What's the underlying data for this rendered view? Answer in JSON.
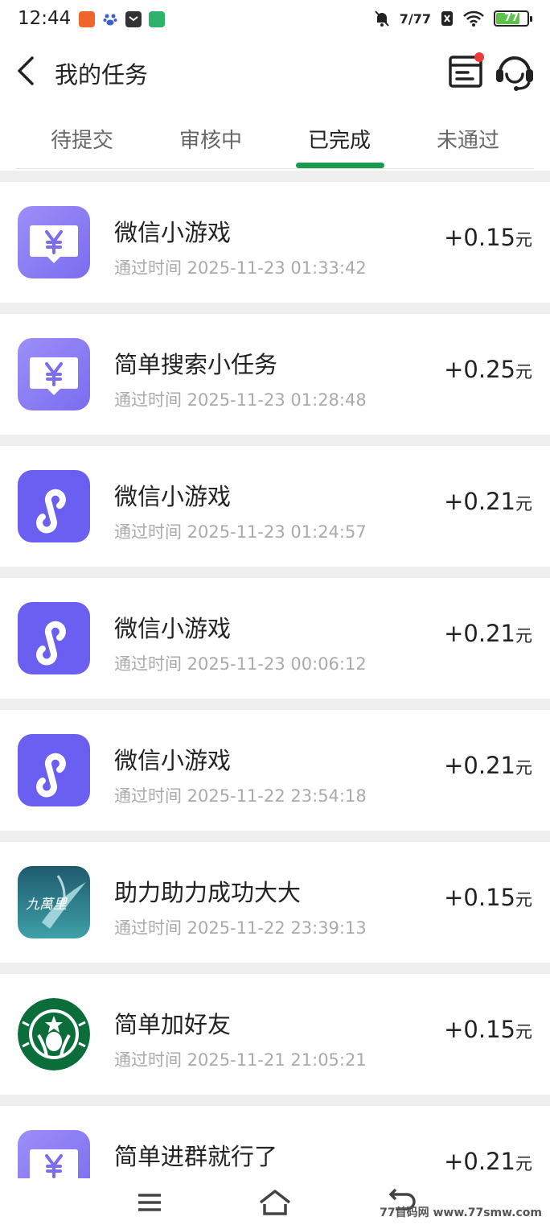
{
  "status_bar": {
    "time": "12:44",
    "signal_text": "7/77",
    "battery_level": "77",
    "notification_icons": [
      {
        "name": "app-orange-icon",
        "color": "#f0662a"
      },
      {
        "name": "paw-icon",
        "color": "#3a5fcf"
      },
      {
        "name": "mail-app-icon",
        "color": "#333333"
      },
      {
        "name": "green-app-icon",
        "color": "#2fb36a"
      }
    ]
  },
  "header": {
    "title": "我的任务"
  },
  "tabs": [
    {
      "label": "待提交",
      "active": false
    },
    {
      "label": "审核中",
      "active": false
    },
    {
      "label": "已完成",
      "active": true
    },
    {
      "label": "未通过",
      "active": false
    }
  ],
  "accent_color": "#1a9a4c",
  "tasks": [
    {
      "title": "微信小游戏",
      "time": "通过时间 2025-11-23 01:33:42",
      "amount": "+0.15",
      "unit": "元",
      "icon": "yuan-icon"
    },
    {
      "title": "简单搜索小任务",
      "time": "通过时间 2025-11-23 01:28:48",
      "amount": "+0.25",
      "unit": "元",
      "icon": "yuan-icon"
    },
    {
      "title": "微信小游戏",
      "time": "通过时间 2025-11-23 01:24:57",
      "amount": "+0.21",
      "unit": "元",
      "icon": "mini-program-icon"
    },
    {
      "title": "微信小游戏",
      "time": "通过时间 2025-11-23 00:06:12",
      "amount": "+0.21",
      "unit": "元",
      "icon": "mini-program-icon"
    },
    {
      "title": "微信小游戏",
      "time": "通过时间 2025-11-22 23:54:18",
      "amount": "+0.21",
      "unit": "元",
      "icon": "mini-program-icon"
    },
    {
      "title": "助力助力成功大大",
      "time": "通过时间 2025-11-22 23:39:13",
      "amount": "+0.15",
      "unit": "元",
      "icon": "jiuwanli-logo-icon",
      "logo_text": "九萬里"
    },
    {
      "title": "简单加好友",
      "time": "通过时间 2025-11-21 21:05:21",
      "amount": "+0.15",
      "unit": "元",
      "icon": "starbucks-logo-icon"
    },
    {
      "title": "简单进群就行了",
      "time": "",
      "amount": "+0.21",
      "unit": "元",
      "icon": "yuan-icon"
    }
  ],
  "watermark": "77首码网 www.77smw.com"
}
